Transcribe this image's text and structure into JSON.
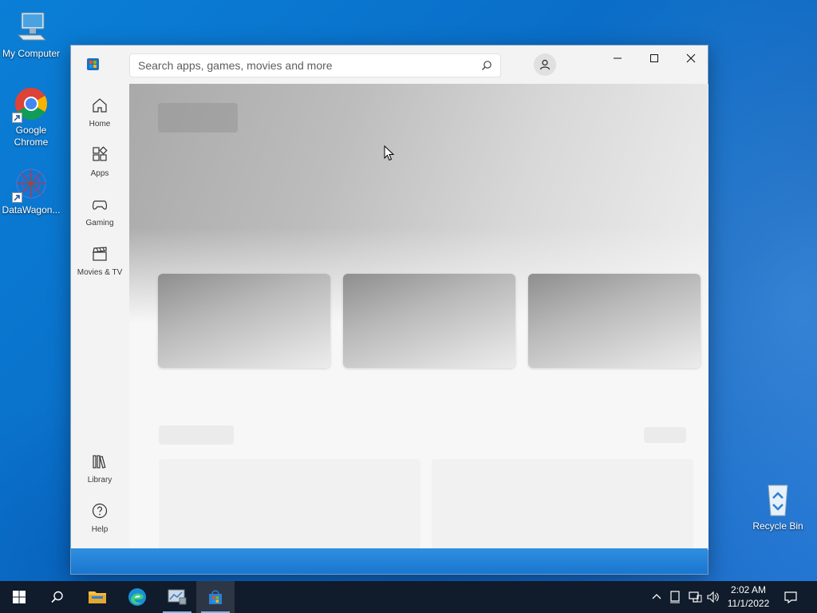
{
  "desktop": {
    "icons": [
      {
        "label": "My Computer"
      },
      {
        "label": "Google Chrome"
      },
      {
        "label": "DataWagon..."
      },
      {
        "label": "Recycle Bin"
      }
    ]
  },
  "store_window": {
    "search": {
      "placeholder": "Search apps, games, movies and more"
    },
    "sidebar": {
      "items": [
        {
          "label": "Home",
          "icon": "home-icon"
        },
        {
          "label": "Apps",
          "icon": "apps-icon"
        },
        {
          "label": "Gaming",
          "icon": "gamepad-icon"
        },
        {
          "label": "Movies & TV",
          "icon": "clapperboard-icon"
        },
        {
          "label": "Library",
          "icon": "library-icon"
        },
        {
          "label": "Help",
          "icon": "help-icon"
        }
      ]
    },
    "colors": {
      "accent": "#1f6fc5",
      "strip": "#1976cf"
    }
  },
  "taskbar": {
    "clock": {
      "time": "2:02 AM",
      "date": "11/1/2022"
    },
    "apps": [
      "start-icon",
      "search-icon",
      "file-explorer-icon",
      "edge-icon",
      "server-manager-icon",
      "store-icon"
    ]
  }
}
